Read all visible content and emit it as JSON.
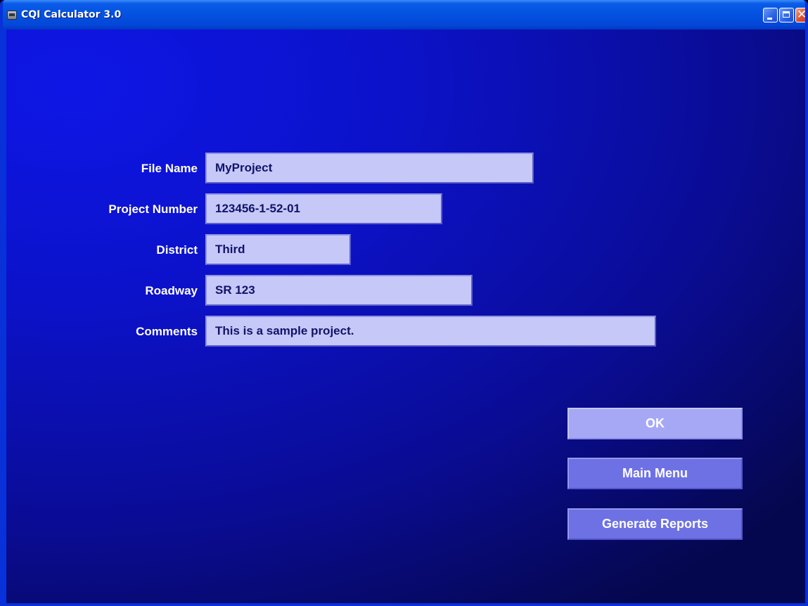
{
  "window": {
    "title": "CQI Calculator 3.0"
  },
  "form": {
    "fields": [
      {
        "label": "File Name",
        "value": "MyProject"
      },
      {
        "label": "Project Number",
        "value": "123456-1-52-01"
      },
      {
        "label": "District",
        "value": "Third"
      },
      {
        "label": "Roadway",
        "value": "SR 123"
      },
      {
        "label": "Comments",
        "value": "This is a sample project."
      }
    ]
  },
  "buttons": {
    "ok": "OK",
    "main_menu": "Main Menu",
    "generate_reports": "Generate Reports"
  },
  "colors": {
    "background": "#0c12c8",
    "field_fill": "#c6c8f7",
    "field_text": "#11136a",
    "button_ok": "#a6a8f6",
    "button": "#6e71e4"
  }
}
